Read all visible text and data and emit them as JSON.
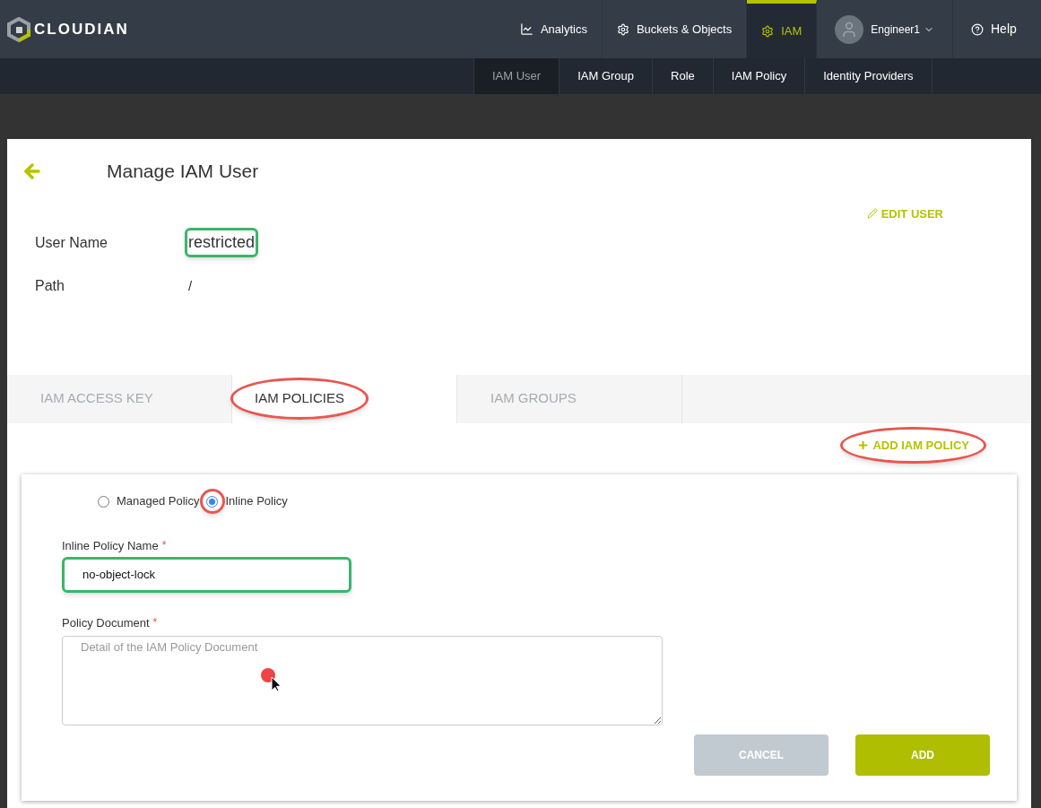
{
  "brand": "CLOUDIAN",
  "nav": [
    {
      "label": "Analytics",
      "selected": false
    },
    {
      "label": "Buckets & Objects",
      "selected": false
    },
    {
      "label": "IAM",
      "selected": true
    }
  ],
  "user_menu": {
    "label": "Engineer1"
  },
  "help": {
    "label": "Help"
  },
  "subnav": [
    {
      "label": "IAM User",
      "selected": true
    },
    {
      "label": "IAM Group",
      "selected": false
    },
    {
      "label": "Role",
      "selected": false
    },
    {
      "label": "IAM Policy",
      "selected": false
    },
    {
      "label": "Identity Providers",
      "selected": false
    }
  ],
  "page": {
    "title": "Manage IAM User",
    "edit_action": "EDIT USER",
    "fields": [
      {
        "label": "User Name",
        "value": "restricted",
        "boxed": true
      },
      {
        "label": "Path",
        "value": "/",
        "boxed": false
      }
    ]
  },
  "tabs": [
    {
      "label": "IAM ACCESS KEY",
      "selected": false,
      "circled": false
    },
    {
      "label": "IAM POLICIES",
      "selected": true,
      "circled": true
    },
    {
      "label": "IAM GROUPS",
      "selected": false,
      "circled": false
    }
  ],
  "add_action": {
    "label": "ADD IAM POLICY",
    "circled": true
  },
  "policy_form": {
    "radios": [
      {
        "label": "Managed Policy",
        "selected": false,
        "circled": false
      },
      {
        "label": "Inline Policy",
        "selected": true,
        "circled": true
      }
    ],
    "name_field": {
      "label": "Inline Policy Name",
      "required_mark": "*",
      "value": "no-object-lock",
      "boxed": true
    },
    "document_field": {
      "label": "Policy Document",
      "required_mark": "*",
      "placeholder": "Detail of the IAM Policy Document"
    },
    "buttons": [
      {
        "label": "CANCEL",
        "kind": "secondary"
      },
      {
        "label": "ADD",
        "kind": "primary"
      }
    ]
  }
}
